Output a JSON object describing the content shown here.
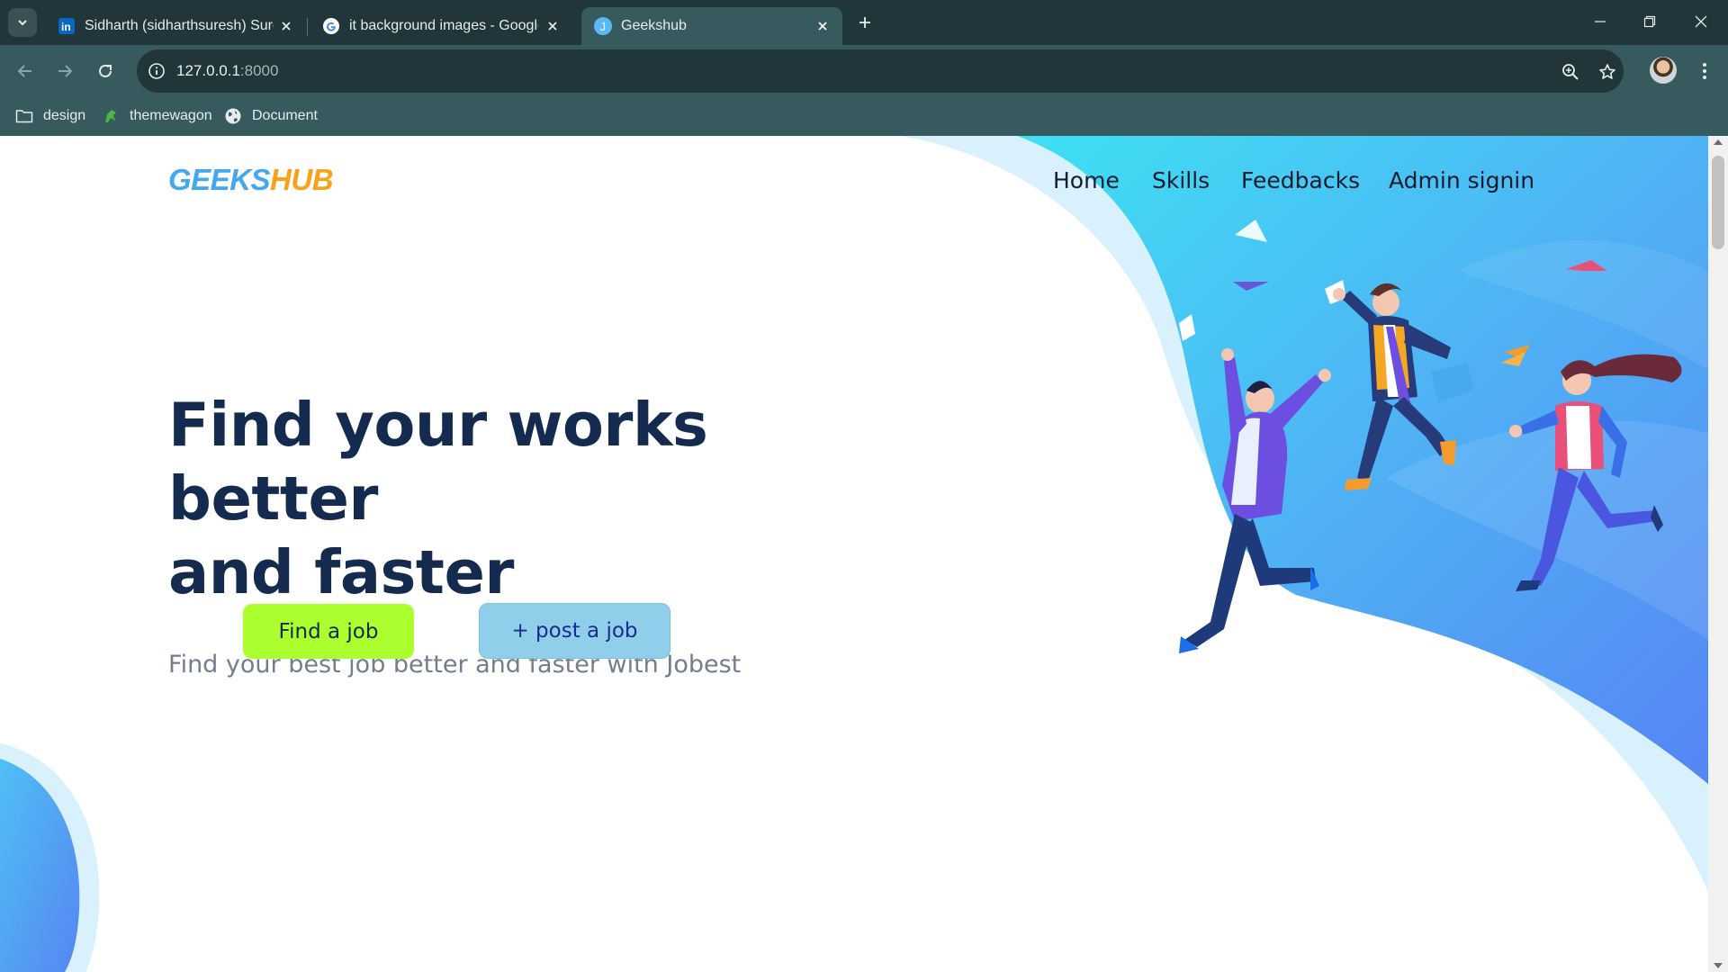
{
  "browser": {
    "tabs": [
      {
        "title": "Sidharth (sidharthsuresh) Suresh",
        "favicon": "linkedin-icon",
        "active": false
      },
      {
        "title": "it background images - Google",
        "favicon": "google-icon",
        "active": false
      },
      {
        "title": "Geekshub",
        "favicon": "j-badge-icon",
        "active": true
      }
    ],
    "favicon_letter": "J",
    "url_host": "127.0.0.1",
    "url_port": ":8000",
    "bookmarks": [
      {
        "label": "design",
        "icon": "folder-icon"
      },
      {
        "label": "themewagon",
        "icon": "themewagon-icon"
      },
      {
        "label": "Document",
        "icon": "globe-icon"
      }
    ],
    "colors": {
      "frame": "#21363a",
      "toolbar": "#375a5e"
    }
  },
  "page": {
    "logo": {
      "part1": "GEEKS",
      "part2": "HUB"
    },
    "nav": [
      "Home",
      "Skills",
      "Feedbacks",
      "Admin signin"
    ],
    "headline": [
      "Find your works",
      "better",
      "and faster"
    ],
    "subheadline": "Find your best job better and faster with Jobest",
    "buttons": {
      "find": "Find a job",
      "post": "+ post a job"
    },
    "colors": {
      "logo_primary": "#44a8ee",
      "logo_accent": "#f7a21b",
      "headline": "#142a4e",
      "find_button": "#acff2f",
      "post_button": "#8fcfea",
      "hero_gradient_start": "#3ee0f3",
      "hero_gradient_end": "#5588f4"
    }
  }
}
